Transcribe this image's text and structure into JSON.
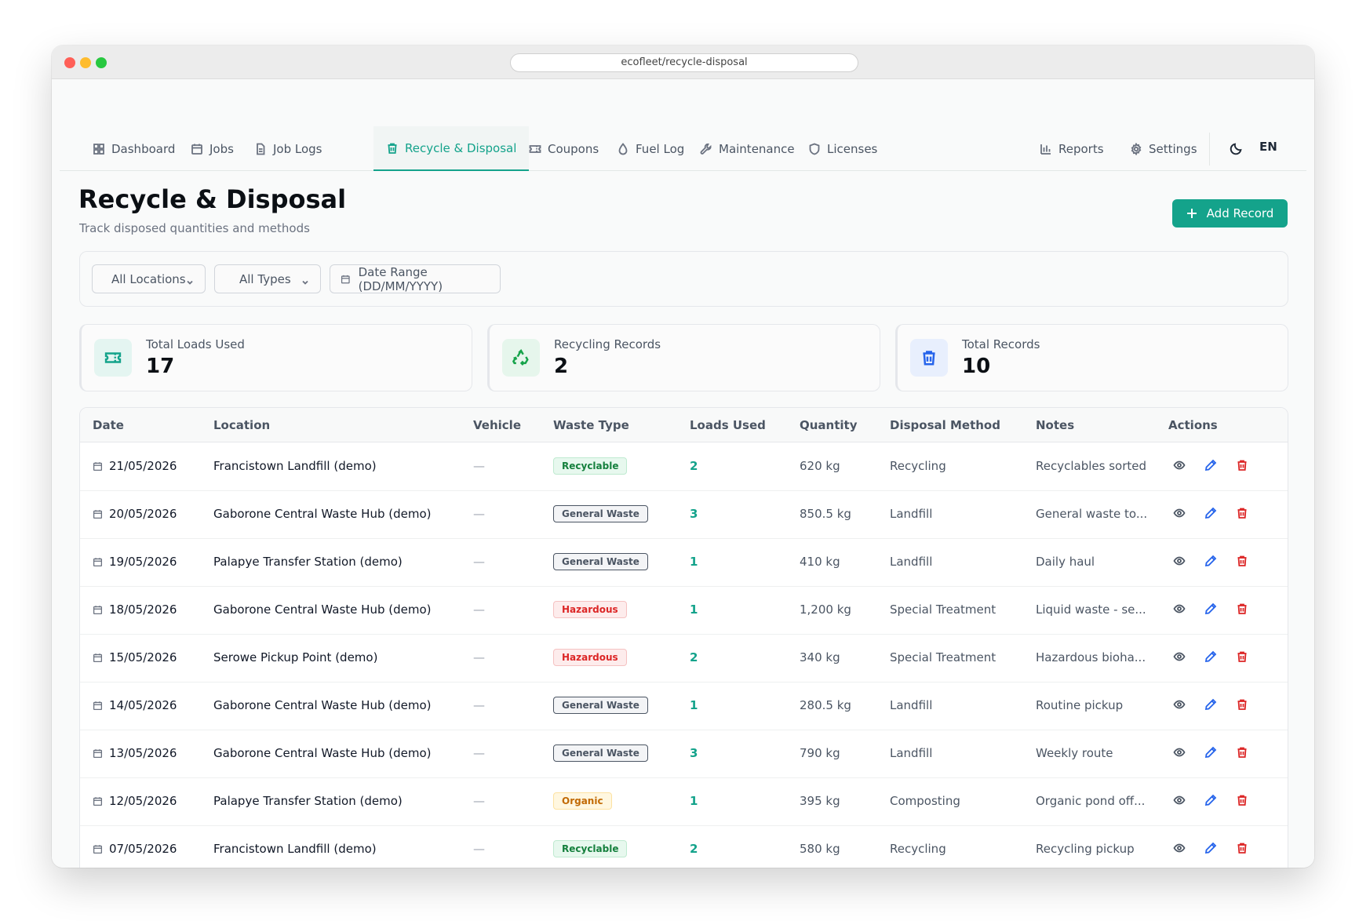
{
  "browser": {
    "url": "ecofleet/recycle-disposal"
  },
  "nav": {
    "items": [
      {
        "label": "Dashboard",
        "icon": "grid-icon",
        "active": false
      },
      {
        "label": "Jobs",
        "icon": "calendar-icon",
        "active": false
      },
      {
        "label": "Job Logs",
        "icon": "document-icon",
        "active": false
      },
      {
        "label": "Recycle & Disposal",
        "icon": "trash-icon",
        "active": true
      },
      {
        "label": "Coupons",
        "icon": "ticket-icon",
        "active": false
      },
      {
        "label": "Fuel Log",
        "icon": "droplet-icon",
        "active": false
      },
      {
        "label": "Maintenance",
        "icon": "wrench-icon",
        "active": false
      },
      {
        "label": "Licenses",
        "icon": "shield-icon",
        "active": false
      }
    ],
    "right_items": [
      {
        "label": "Reports",
        "icon": "bar-chart-icon"
      },
      {
        "label": "Settings",
        "icon": "gear-icon"
      }
    ],
    "theme_icon": "moon-icon",
    "language": "EN"
  },
  "page": {
    "title": "Recycle & Disposal",
    "subtitle": "Track disposed quantities and methods",
    "add_button_label": "Add Record"
  },
  "filters": {
    "location": "All Locations",
    "type": "All Types",
    "date_range": "Date Range (DD/MM/YYYY)"
  },
  "stats": [
    {
      "label": "Total Loads Used",
      "value": "17",
      "icon": "ticket-icon",
      "color": "#14a38b"
    },
    {
      "label": "Recycling Records",
      "value": "2",
      "icon": "recycle-icon",
      "color": "#16a34a"
    },
    {
      "label": "Total Records",
      "value": "10",
      "icon": "trash-icon",
      "color": "#2563eb"
    }
  ],
  "table": {
    "columns": [
      "Date",
      "Location",
      "Vehicle",
      "Waste Type",
      "Loads Used",
      "Quantity",
      "Disposal Method",
      "Notes",
      "Actions"
    ],
    "rows": [
      {
        "date": "21/05/2026",
        "location": "Francistown Landfill (demo)",
        "vehicle": "—",
        "waste_type": "Recyclable",
        "waste_class": "recyclable",
        "loads": "2",
        "quantity": "620 kg",
        "method": "Recycling",
        "notes": "Recyclables sorted"
      },
      {
        "date": "20/05/2026",
        "location": "Gaborone Central Waste Hub (demo)",
        "vehicle": "—",
        "waste_type": "General Waste",
        "waste_class": "general",
        "loads": "3",
        "quantity": "850.5 kg",
        "method": "Landfill",
        "notes": "General waste to..."
      },
      {
        "date": "19/05/2026",
        "location": "Palapye Transfer Station (demo)",
        "vehicle": "—",
        "waste_type": "General Waste",
        "waste_class": "general",
        "loads": "1",
        "quantity": "410 kg",
        "method": "Landfill",
        "notes": "Daily haul"
      },
      {
        "date": "18/05/2026",
        "location": "Gaborone Central Waste Hub (demo)",
        "vehicle": "—",
        "waste_type": "Hazardous",
        "waste_class": "hazardous",
        "loads": "1",
        "quantity": "1,200 kg",
        "method": "Special Treatment",
        "notes": "Liquid waste - se..."
      },
      {
        "date": "15/05/2026",
        "location": "Serowe Pickup Point (demo)",
        "vehicle": "—",
        "waste_type": "Hazardous",
        "waste_class": "hazardous",
        "loads": "2",
        "quantity": "340 kg",
        "method": "Special Treatment",
        "notes": "Hazardous bioha..."
      },
      {
        "date": "14/05/2026",
        "location": "Gaborone Central Waste Hub (demo)",
        "vehicle": "—",
        "waste_type": "General Waste",
        "waste_class": "general",
        "loads": "1",
        "quantity": "280.5 kg",
        "method": "Landfill",
        "notes": "Routine pickup"
      },
      {
        "date": "13/05/2026",
        "location": "Gaborone Central Waste Hub (demo)",
        "vehicle": "—",
        "waste_type": "General Waste",
        "waste_class": "general",
        "loads": "3",
        "quantity": "790 kg",
        "method": "Landfill",
        "notes": "Weekly route"
      },
      {
        "date": "12/05/2026",
        "location": "Palapye Transfer Station (demo)",
        "vehicle": "—",
        "waste_type": "Organic",
        "waste_class": "organic",
        "loads": "1",
        "quantity": "395 kg",
        "method": "Composting",
        "notes": "Organic pond off..."
      },
      {
        "date": "07/05/2026",
        "location": "Francistown Landfill (demo)",
        "vehicle": "—",
        "waste_type": "Recyclable",
        "waste_class": "recyclable",
        "loads": "2",
        "quantity": "580 kg",
        "method": "Recycling",
        "notes": "Recycling pickup"
      }
    ]
  },
  "colors": {
    "accent": "#14a38b",
    "view": "#4b5563",
    "edit": "#2563eb",
    "delete": "#dc2626"
  }
}
